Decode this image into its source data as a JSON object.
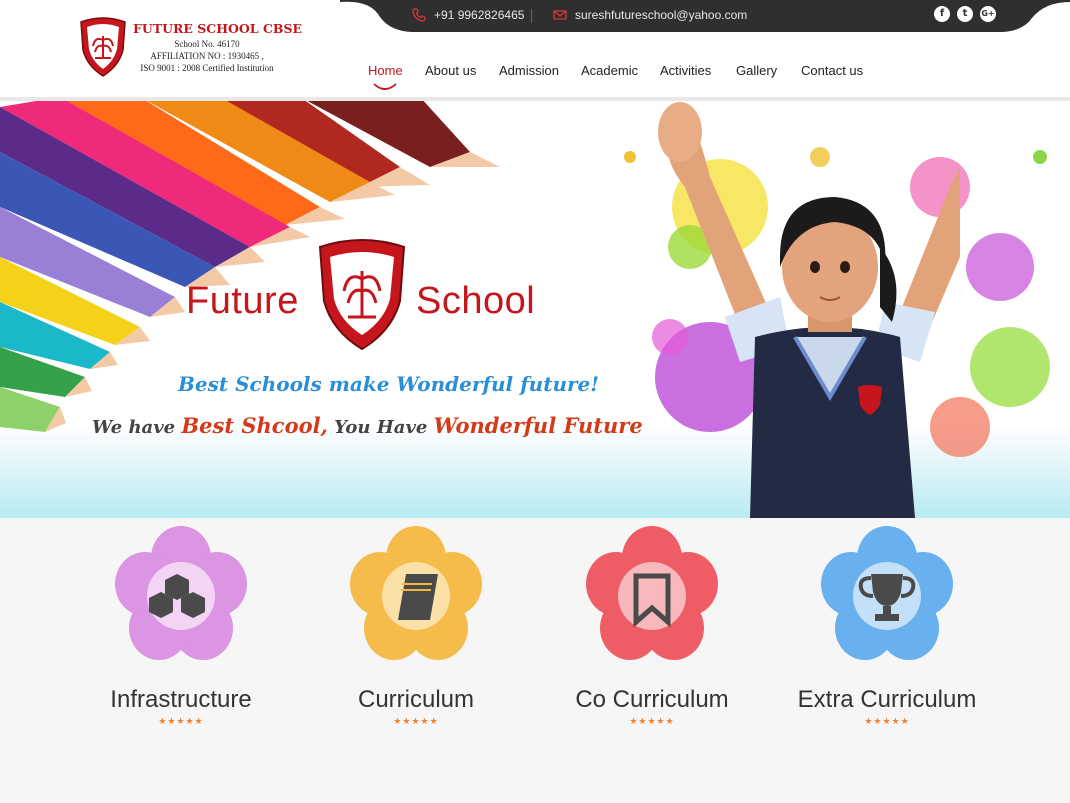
{
  "topbar": {
    "phone": "+91 9962826465",
    "email": "sureshfutureschool@yahoo.com",
    "social": [
      {
        "icon": "facebook-icon",
        "glyph": "f"
      },
      {
        "icon": "twitter-icon",
        "glyph": "t"
      },
      {
        "icon": "google-plus-icon",
        "glyph": "G+"
      }
    ]
  },
  "logo": {
    "name": "FUTURE SCHOOL CBSE",
    "school_no": "School No. 46170",
    "affiliation": "AFFILIATION NO : 1930465 ,",
    "iso": "ISO 9001 : 2008 Certified Institution"
  },
  "nav": {
    "items": [
      {
        "label": "Home",
        "active": true
      },
      {
        "label": "About us"
      },
      {
        "label": "Admission"
      },
      {
        "label": "Academic"
      },
      {
        "label": "Activities"
      },
      {
        "label": "Gallery"
      },
      {
        "label": "Contact us"
      }
    ]
  },
  "hero": {
    "title_left": "Future",
    "title_right": "School",
    "tagline": "Best Schools make Wonderful future!",
    "motto": {
      "part1": "We have ",
      "part2": "Best Shcool,",
      "part3": " You Have ",
      "part4": "Wonderful Future"
    }
  },
  "features": [
    {
      "label": "Infrastructure",
      "icon": "cubes-icon",
      "color": "#d98be0",
      "stars": "★★★★★"
    },
    {
      "label": "Curriculum",
      "icon": "book-icon",
      "color": "#f5b63a",
      "stars": "★★★★★"
    },
    {
      "label": "Co Curriculum",
      "icon": "bookmark-icon",
      "color": "#ee4d57",
      "stars": "★★★★★"
    },
    {
      "label": "Extra Curriculum",
      "icon": "trophy-icon",
      "color": "#5aa9ee",
      "stars": "★★★★★"
    }
  ],
  "colors": {
    "brand_red": "#c4161c",
    "topbar": "#2f2f2f",
    "star_orange": "#f08030",
    "tagline_blue": "#2a8fd6"
  }
}
